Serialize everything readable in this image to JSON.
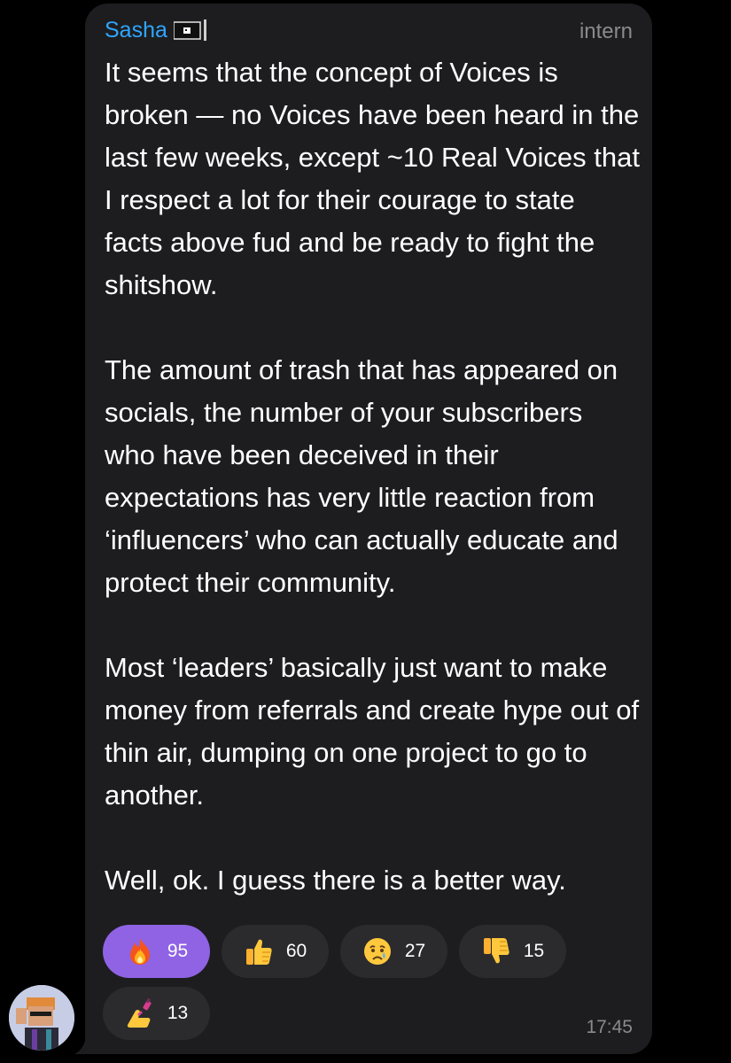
{
  "message": {
    "sender": "Sasha",
    "role_badge": "intern",
    "paragraphs": [
      "It seems that the concept of Voices is broken — no Voices have been heard in the last few weeks, except ~10 Real Voices that I respect a lot for their courage to state facts above fud and be ready to fight the shitshow.",
      "The amount of trash that has appeared on socials, the number of your subscribers who have been deceived in their expectations has very little reaction from ‘influencers’ who can actually educate and protect their community.",
      "Most ‘leaders’ basically just want to make money from referrals and create hype out of thin air, dumping on one project to go to another.",
      "Well, ok. I guess there is a better way."
    ],
    "time": "17:45"
  },
  "reactions": [
    {
      "icon": "fire-emoji-icon",
      "count": "95",
      "selected": true
    },
    {
      "icon": "thumbs-up-emoji-icon",
      "count": "60",
      "selected": false
    },
    {
      "icon": "crying-face-emoji-icon",
      "count": "27",
      "selected": false
    },
    {
      "icon": "thumbs-down-emoji-icon",
      "count": "15",
      "selected": false
    },
    {
      "icon": "nail-polish-emoji-icon",
      "count": "13",
      "selected": false
    }
  ],
  "colors": {
    "background": "#000000",
    "bubble": "#1d1d1f",
    "sender_name": "#2ea6ff",
    "selected_reaction": "#8f63e4",
    "reaction": "#2b2b2e",
    "meta_text": "#8a8a8e"
  }
}
